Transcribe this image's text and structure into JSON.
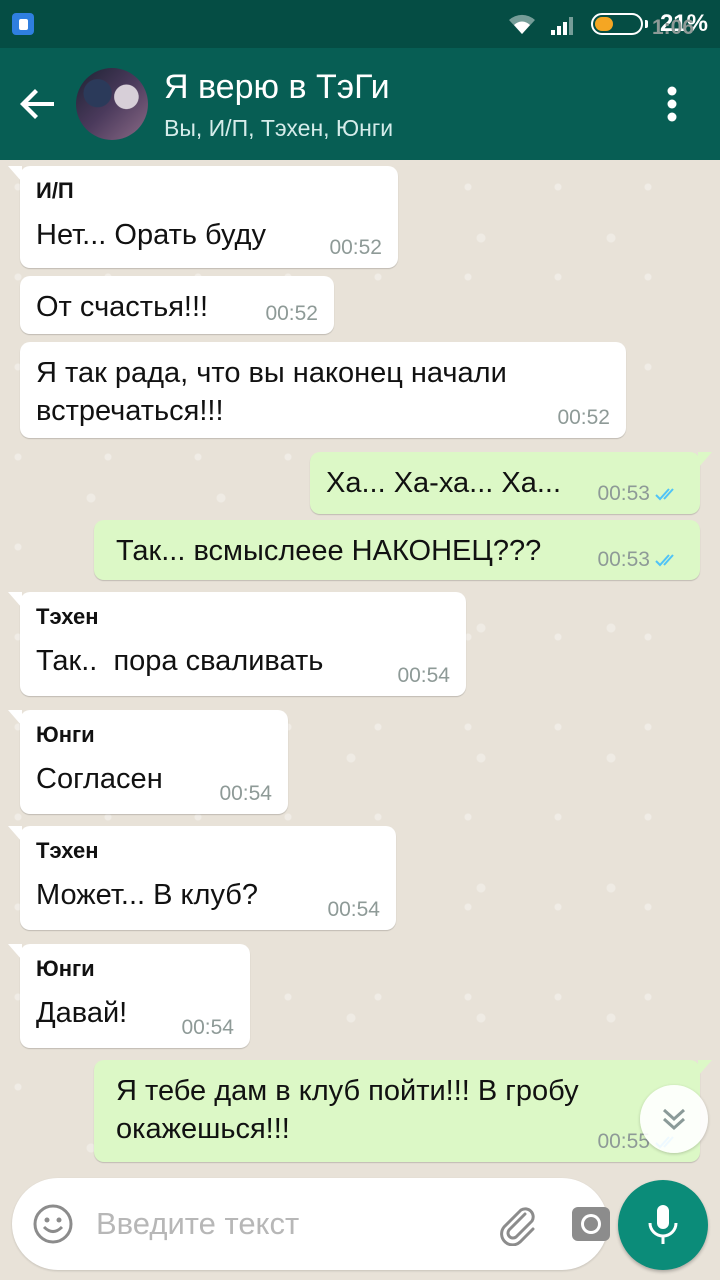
{
  "status_bar": {
    "time": "1:06",
    "battery": "21%",
    "battery_level": 0.21
  },
  "header": {
    "title": "Я верю в ТэГи",
    "subtitle": "Вы, И/П, Тэхен, Юнги"
  },
  "messages": [
    {
      "sender": "И/П",
      "text": "Нет... Орать буду",
      "time": "00:52"
    },
    {
      "text": "От счастья!!!",
      "time": "00:52"
    },
    {
      "text": "Я так рада, что вы наконец начали встречаться!!!",
      "time": "00:52"
    },
    {
      "text": "Ха... Ха-ха... Ха...",
      "time": "00:53"
    },
    {
      "text": "Так... всмыслеее НАКОНЕЦ???",
      "time": "00:53"
    },
    {
      "sender": "Тэхен",
      "text": "Так..  пора сваливать",
      "time": "00:54"
    },
    {
      "sender": "Юнги",
      "text": "Согласен",
      "time": "00:54"
    },
    {
      "sender": "Тэхен",
      "text": "Может... В клуб?",
      "time": "00:54"
    },
    {
      "sender": "Юнги",
      "text": "Давай!",
      "time": "00:54"
    },
    {
      "text": "Я тебе дам в клуб пойти!!! В гробу окажешься!!!",
      "time": "00:55"
    }
  ],
  "composer": {
    "placeholder": "Введите текст"
  },
  "icons": {
    "back": "arrow-left-icon",
    "menu": "more-vert-icon",
    "emoji": "emoji-icon",
    "attach": "paperclip-icon",
    "camera": "camera-icon",
    "mic": "mic-icon",
    "scroll": "double-chevron-down-icon",
    "read": "double-check-icon"
  },
  "colors": {
    "header": "#075e54",
    "status_bar": "#054d44",
    "outgoing_bubble": "#dcf8c6",
    "incoming_bubble": "#ffffff",
    "read_ticks": "#4fc3f7",
    "mic_button": "#0b8c79"
  }
}
